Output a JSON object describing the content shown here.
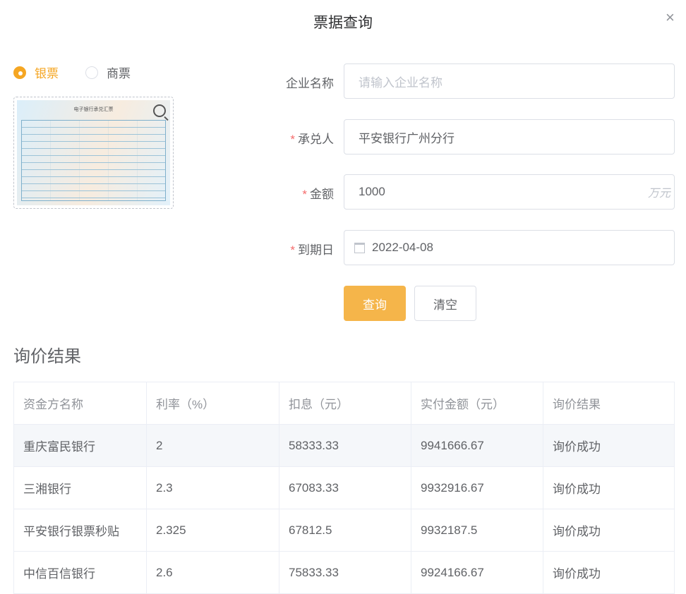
{
  "dialog": {
    "title": "票据查询",
    "close_icon": "×"
  },
  "bill_type": {
    "options": [
      {
        "label": "银票",
        "selected": true
      },
      {
        "label": "商票",
        "selected": false
      }
    ]
  },
  "ticket_image": {
    "title": "电子银行承兑汇票"
  },
  "form": {
    "company": {
      "label": "企业名称",
      "placeholder": "请输入企业名称",
      "value": ""
    },
    "acceptor": {
      "label": "承兑人",
      "value": "平安银行广州分行",
      "required": "*"
    },
    "amount": {
      "label": "金额",
      "value": "1000",
      "suffix": "万元",
      "required": "*"
    },
    "due_date": {
      "label": "到期日",
      "value": "2022-04-08",
      "required": "*"
    },
    "query_label": "查询",
    "clear_label": "清空"
  },
  "results": {
    "title": "询价结果",
    "columns": [
      "资金方名称",
      "利率（%）",
      "扣息（元）",
      "实付金额（元）",
      "询价结果"
    ],
    "rows": [
      [
        "重庆富民银行",
        "2",
        "58333.33",
        "9941666.67",
        "询价成功"
      ],
      [
        "三湘银行",
        "2.3",
        "67083.33",
        "9932916.67",
        "询价成功"
      ],
      [
        "平安银行银票秒贴",
        "2.325",
        "67812.5",
        "9932187.5",
        "询价成功"
      ],
      [
        "中信百信银行",
        "2.6",
        "75833.33",
        "9924166.67",
        "询价成功"
      ]
    ]
  },
  "colors": {
    "accent": "#f5a623",
    "button": "#f5b54a",
    "required": "#f56c6c"
  }
}
